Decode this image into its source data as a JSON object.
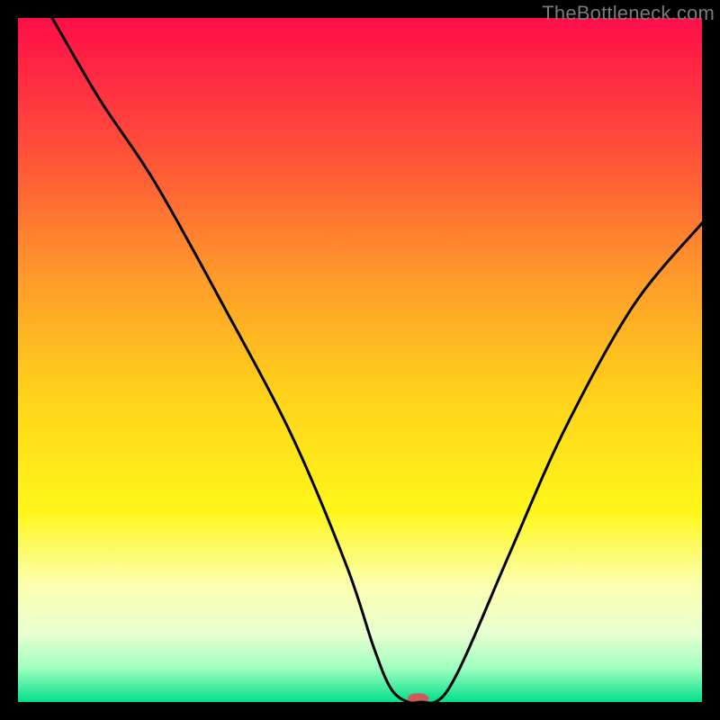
{
  "watermark": "TheBottleneck.com",
  "chart_data": {
    "type": "line",
    "title": "",
    "xlabel": "",
    "ylabel": "",
    "xlim": [
      0,
      100
    ],
    "ylim": [
      0,
      100
    ],
    "grid": false,
    "annotations": [],
    "gradient_background": {
      "stops": [
        {
          "pos": 0.0,
          "color": "#ff0e4a"
        },
        {
          "pos": 0.18,
          "color": "#ff4a3a"
        },
        {
          "pos": 0.38,
          "color": "#ff9a2a"
        },
        {
          "pos": 0.55,
          "color": "#ffd21a"
        },
        {
          "pos": 0.72,
          "color": "#fff61a"
        },
        {
          "pos": 0.83,
          "color": "#fbffb0"
        },
        {
          "pos": 0.9,
          "color": "#e8ffd0"
        },
        {
          "pos": 0.95,
          "color": "#a0ffc0"
        },
        {
          "pos": 1.0,
          "color": "#00e08a"
        }
      ]
    },
    "series": [
      {
        "name": "bottleneck-curve",
        "x": [
          5,
          12,
          20,
          30,
          40,
          48,
          52,
          54.5,
          57,
          59,
          61,
          63,
          66,
          72,
          80,
          90,
          100
        ],
        "y": [
          100,
          88,
          76,
          58,
          39,
          20,
          8,
          2,
          0,
          0,
          0,
          2,
          8,
          22,
          40,
          58,
          70
        ]
      }
    ],
    "marker": {
      "name": "optimal-point",
      "x": 58.5,
      "y": 0.5,
      "color": "#d05a5a",
      "rx": 12,
      "ry": 6
    }
  }
}
